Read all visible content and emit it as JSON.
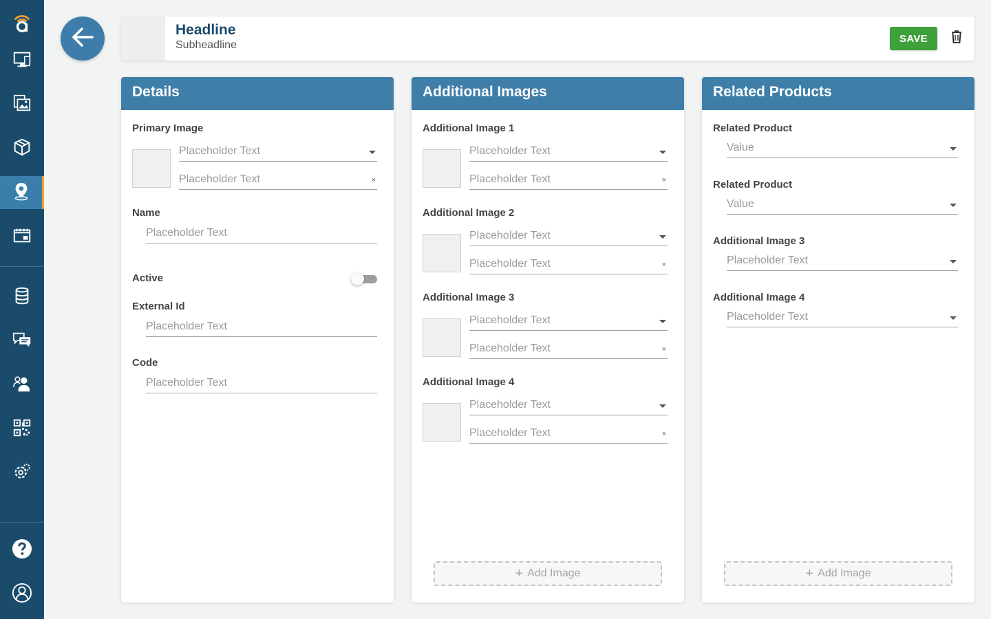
{
  "header": {
    "headline": "Headline",
    "subheadline": "Subheadline",
    "save_label": "SAVE"
  },
  "sidebar": {
    "items": [
      {
        "icon": "logo-icon"
      },
      {
        "icon": "monitor-icon"
      },
      {
        "icon": "media-icon"
      },
      {
        "icon": "box-icon"
      },
      {
        "icon": "location-icon",
        "active": true
      },
      {
        "icon": "calendar-icon"
      },
      {
        "icon": "database-icon"
      },
      {
        "icon": "chat-icon"
      },
      {
        "icon": "users-icon"
      },
      {
        "icon": "qr-code-icon"
      },
      {
        "icon": "gear-icon"
      },
      {
        "icon": "help-icon"
      },
      {
        "icon": "profile-icon"
      }
    ],
    "active_indicator_color": "#f0a030"
  },
  "details": {
    "title": "Details",
    "primary_image": {
      "label": "Primary Image",
      "select_placeholder": "Placeholder Text",
      "input_placeholder": "Placeholder Text",
      "clear": "×"
    },
    "name": {
      "label": "Name",
      "placeholder": "Placeholder Text"
    },
    "active": {
      "label": "Active",
      "value": false
    },
    "external_id": {
      "label": "External Id",
      "placeholder": "Placeholder Text"
    },
    "code": {
      "label": "Code",
      "placeholder": "Placeholder Text"
    }
  },
  "additional_images": {
    "title": "Additional Images",
    "items": [
      {
        "label": "Additional Image 1",
        "select_placeholder": "Placeholder Text",
        "input_placeholder": "Placeholder Text",
        "clear": "×"
      },
      {
        "label": "Additional Image 2",
        "select_placeholder": "Placeholder Text",
        "input_placeholder": "Placeholder Text",
        "clear": "×"
      },
      {
        "label": "Additional Image 3",
        "select_placeholder": "Placeholder Text",
        "input_placeholder": "Placeholder Text",
        "clear": "×"
      },
      {
        "label": "Additional Image 4",
        "select_placeholder": "Placeholder Text",
        "input_placeholder": "Placeholder Text",
        "clear": "×"
      }
    ],
    "add_label": "Add Image"
  },
  "related_products": {
    "title": "Related Products",
    "items": [
      {
        "label": "Related Product",
        "placeholder": "Value"
      },
      {
        "label": "Related Product",
        "placeholder": "Value"
      },
      {
        "label": "Additional Image 3",
        "placeholder": "Placeholder Text"
      },
      {
        "label": "Additional Image 4",
        "placeholder": "Placeholder Text"
      }
    ],
    "add_label": "Add Image"
  },
  "colors": {
    "sidebar": "#1b4b6b",
    "panel_header": "#3f7ea9",
    "save": "#3fa13b",
    "accent": "#f0a030"
  }
}
